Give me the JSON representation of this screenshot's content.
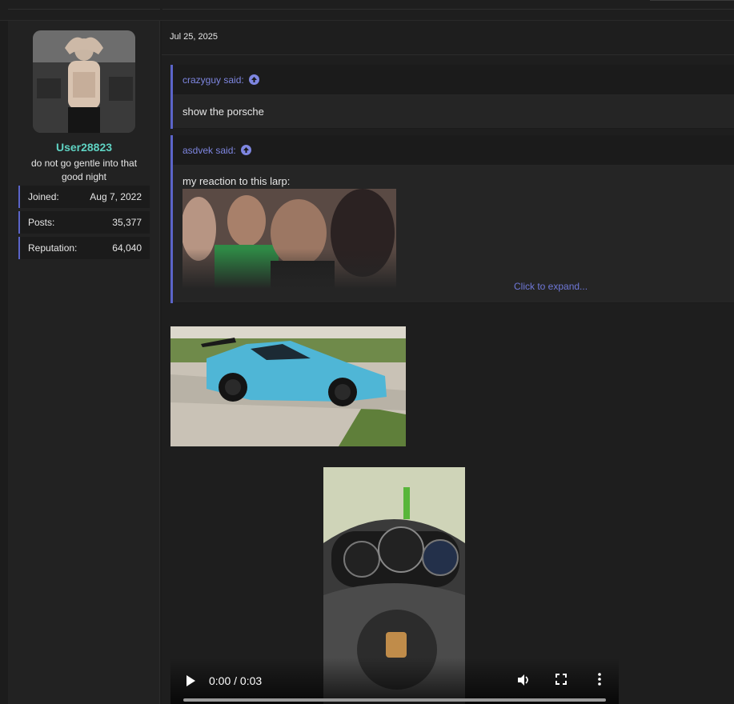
{
  "sidebar": {
    "username": "User28823",
    "user_title": "do not go gentle into that good night",
    "stats": [
      {
        "label": "Joined:",
        "value": "Aug 7, 2022"
      },
      {
        "label": "Posts:",
        "value": "35,377"
      },
      {
        "label": "Reputation:",
        "value": "64,040"
      }
    ]
  },
  "post": {
    "date": "Jul 25, 2025",
    "quotes": [
      {
        "author": "crazyguy said:",
        "text": "show the porsche"
      },
      {
        "author": "asdvek said:",
        "text": "my reaction to this larp:",
        "expand_label": "Click to expand..."
      }
    ]
  },
  "video": {
    "time": "0:00 / 0:03"
  },
  "colors": {
    "accent": "#5b64c9",
    "link": "#7e86e0",
    "username": "#5fd3c3",
    "background": "#1c1c1c"
  }
}
